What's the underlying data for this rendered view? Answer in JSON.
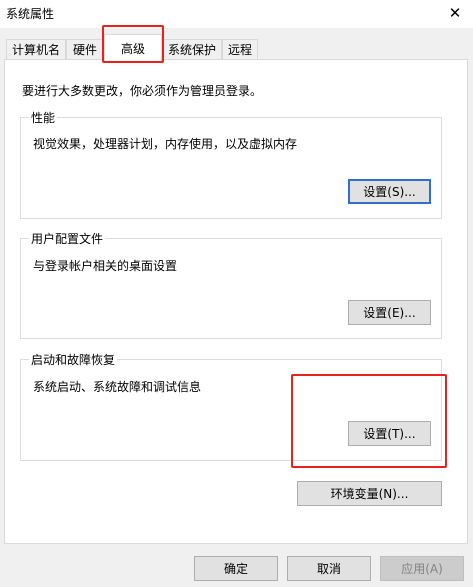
{
  "window": {
    "title": "系统属性",
    "close_glyph": "✕"
  },
  "tabs": [
    {
      "label": "计算机名",
      "active": false
    },
    {
      "label": "硬件",
      "active": false
    },
    {
      "label": "高级",
      "active": true
    },
    {
      "label": "系统保护",
      "active": false
    },
    {
      "label": "远程",
      "active": false
    }
  ],
  "advanced": {
    "admin_note": "要进行大多数更改，你必须作为管理员登录。",
    "performance": {
      "label": "性能",
      "description": "视觉效果，处理器计划，内存使用，以及虚拟内存",
      "settings_button": "设置(S)..."
    },
    "user_profiles": {
      "label": "用户配置文件",
      "description": "与登录帐户相关的桌面设置",
      "settings_button": "设置(E)..."
    },
    "startup_recovery": {
      "label": "启动和故障恢复",
      "description": "系统启动、系统故障和调试信息",
      "settings_button": "设置(T)..."
    },
    "env_vars_button": "环境变量(N)..."
  },
  "footer": {
    "ok": "确定",
    "cancel": "取消",
    "apply": "应用(A)"
  },
  "colors": {
    "annotation_red": "#e8231c",
    "focus_blue": "#2f6fd0",
    "window_bg": "#f0f0f0",
    "panel_bg": "#ffffff"
  }
}
